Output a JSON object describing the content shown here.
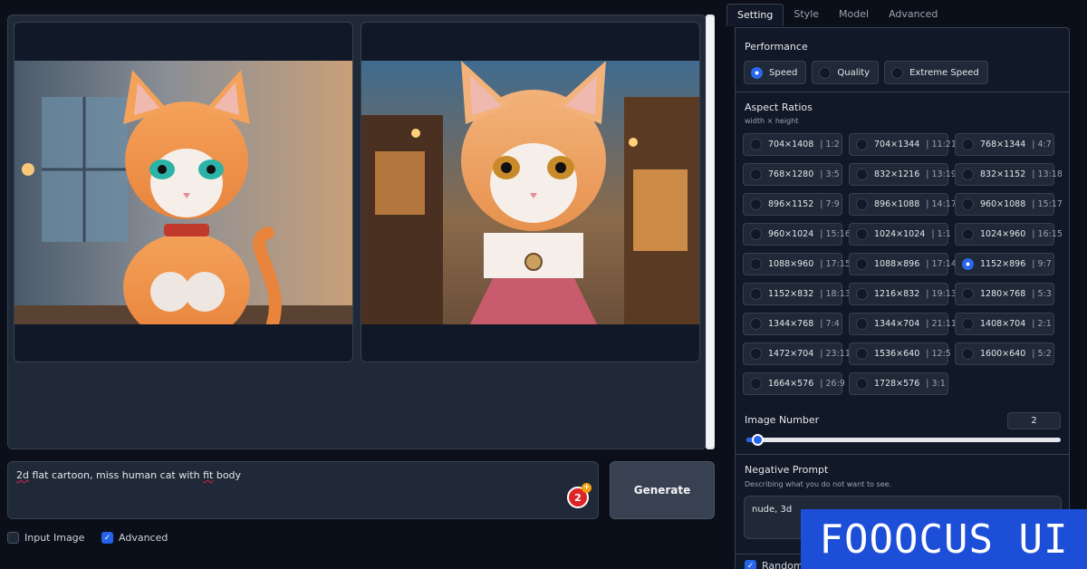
{
  "gallery": {
    "images": [
      {
        "name": "generated-image-1"
      },
      {
        "name": "generated-image-2"
      }
    ]
  },
  "prompt": {
    "value": "2d flat cartoon, miss human cat with fit body",
    "badge_count": "2",
    "badge_plus": "+"
  },
  "generate_label": "Generate",
  "options": {
    "input_image": {
      "label": "Input Image",
      "checked": false
    },
    "advanced": {
      "label": "Advanced",
      "checked": true
    }
  },
  "tabs": [
    "Setting",
    "Style",
    "Model",
    "Advanced"
  ],
  "active_tab": "Setting",
  "performance": {
    "title": "Performance",
    "options": [
      "Speed",
      "Quality",
      "Extreme Speed"
    ],
    "selected": "Speed"
  },
  "aspect_ratios": {
    "title": "Aspect Ratios",
    "subtitle": "width × height",
    "options": [
      {
        "size": "704×1408",
        "ratio": "1:2"
      },
      {
        "size": "704×1344",
        "ratio": "11:21"
      },
      {
        "size": "768×1344",
        "ratio": "4:7"
      },
      {
        "size": "768×1280",
        "ratio": "3:5"
      },
      {
        "size": "832×1216",
        "ratio": "13:19"
      },
      {
        "size": "832×1152",
        "ratio": "13:18"
      },
      {
        "size": "896×1152",
        "ratio": "7:9"
      },
      {
        "size": "896×1088",
        "ratio": "14:17"
      },
      {
        "size": "960×1088",
        "ratio": "15:17"
      },
      {
        "size": "960×1024",
        "ratio": "15:16"
      },
      {
        "size": "1024×1024",
        "ratio": "1:1"
      },
      {
        "size": "1024×960",
        "ratio": "16:15"
      },
      {
        "size": "1088×960",
        "ratio": "17:15"
      },
      {
        "size": "1088×896",
        "ratio": "17:14"
      },
      {
        "size": "1152×896",
        "ratio": "9:7"
      },
      {
        "size": "1152×832",
        "ratio": "18:13"
      },
      {
        "size": "1216×832",
        "ratio": "19:13"
      },
      {
        "size": "1280×768",
        "ratio": "5:3"
      },
      {
        "size": "1344×768",
        "ratio": "7:4"
      },
      {
        "size": "1344×704",
        "ratio": "21:11"
      },
      {
        "size": "1408×704",
        "ratio": "2:1"
      },
      {
        "size": "1472×704",
        "ratio": "23:11"
      },
      {
        "size": "1536×640",
        "ratio": "12:5"
      },
      {
        "size": "1600×640",
        "ratio": "5:2"
      },
      {
        "size": "1664×576",
        "ratio": "26:9"
      },
      {
        "size": "1728×576",
        "ratio": "3:1"
      }
    ],
    "selected": "1152×896"
  },
  "image_number": {
    "title": "Image Number",
    "value": "2",
    "slider_fraction": 0.03
  },
  "negative_prompt": {
    "title": "Negative Prompt",
    "subtitle": "Describing what you do not want to see.",
    "value": "nude, 3d"
  },
  "random": {
    "label": "Random",
    "checked": true
  },
  "brand": "FOOOCUS UI",
  "colors": {
    "accent": "#2563eb",
    "background": "#0b0f19",
    "panel": "#111827",
    "brand": "#1d4ed8"
  }
}
